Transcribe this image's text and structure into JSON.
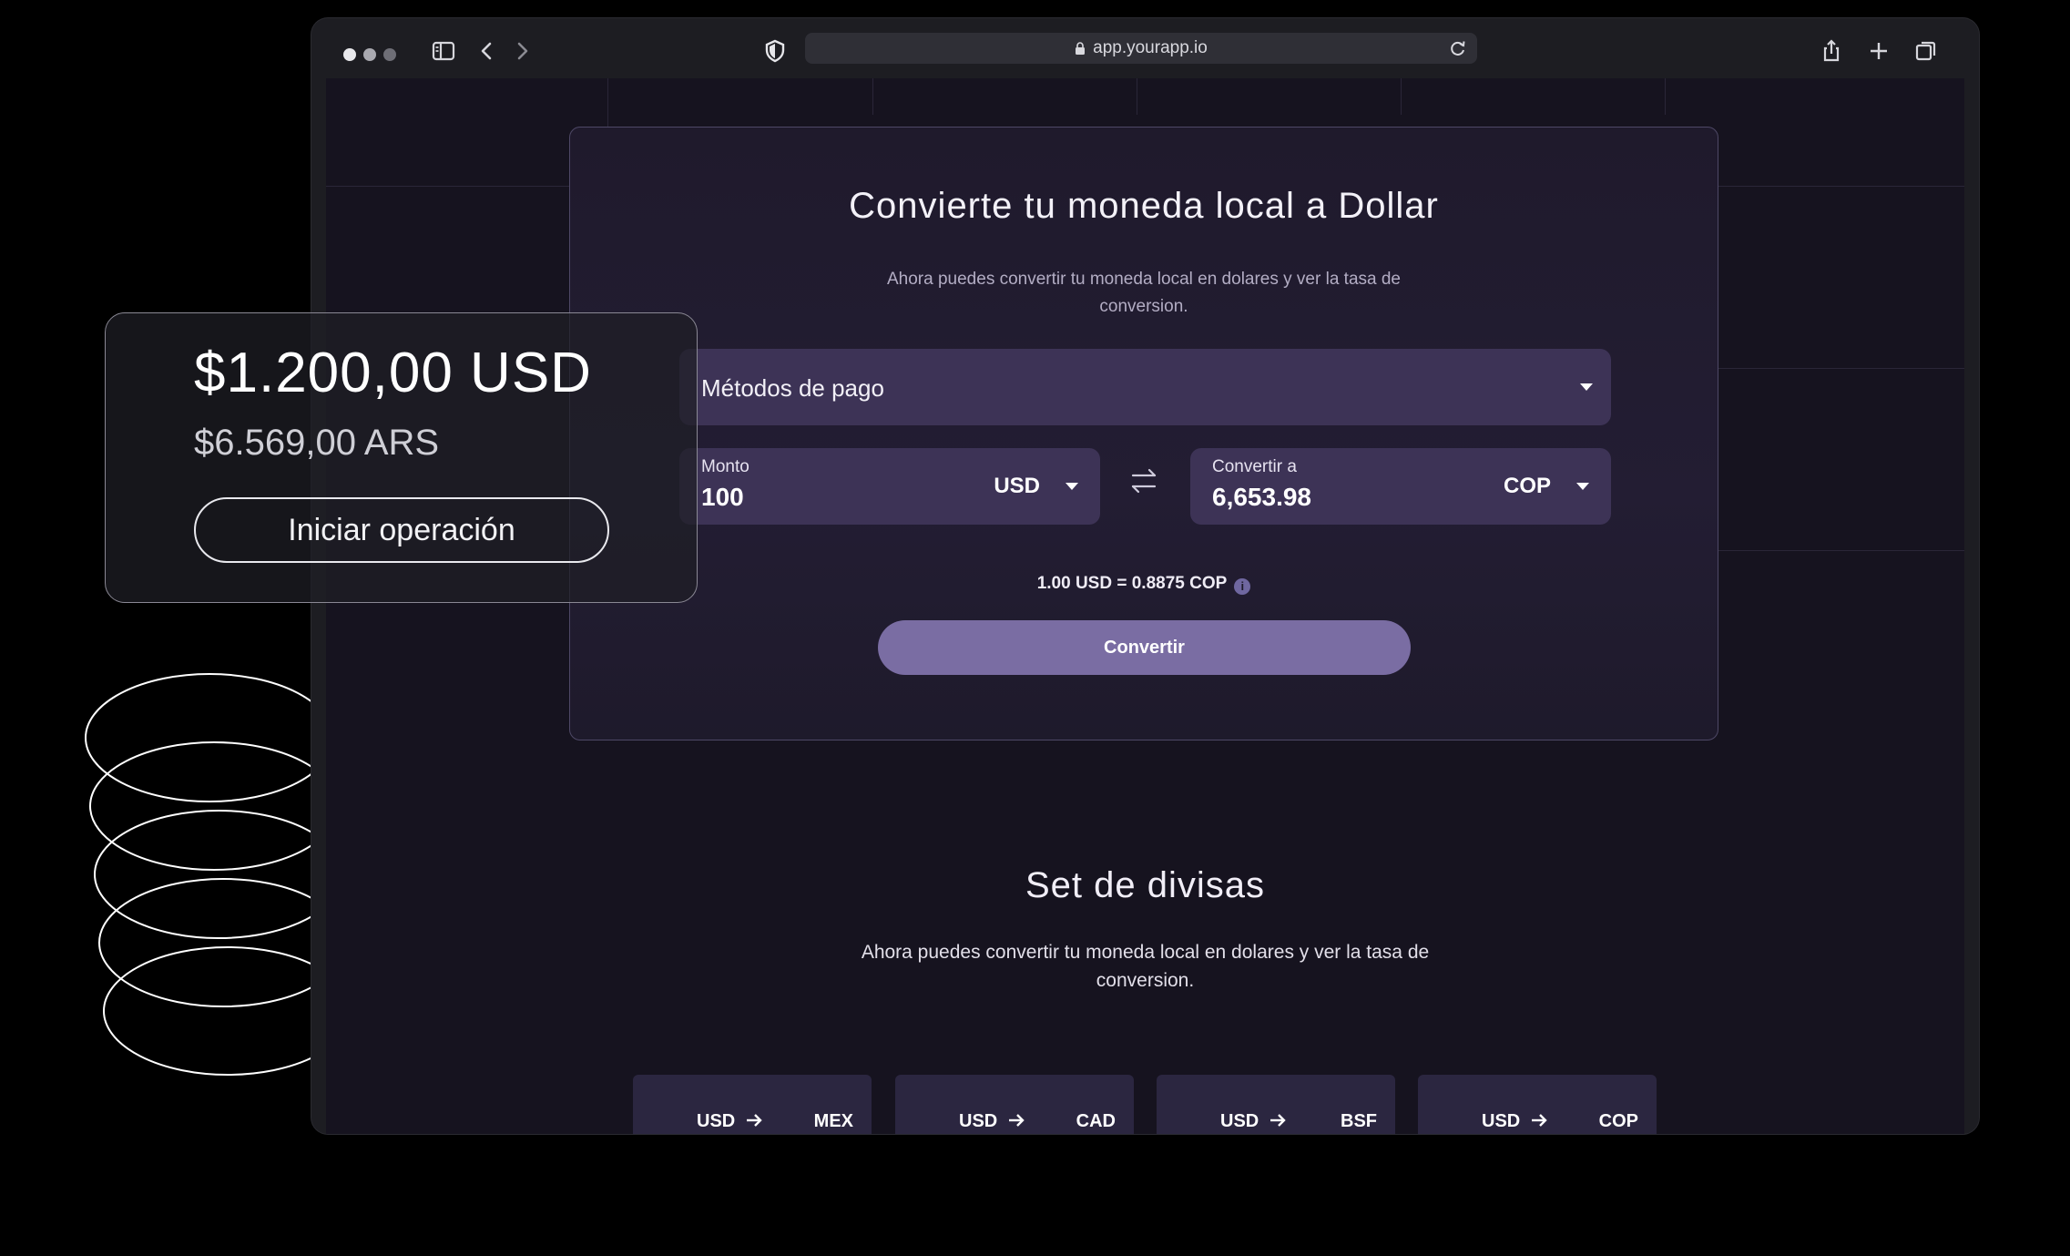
{
  "browser": {
    "url": "app.yourapp.io"
  },
  "converter": {
    "title": "Convierte tu moneda local a Dollar",
    "subtitle": "Ahora puedes convertir tu moneda local en dolares y ver la tasa de conversion.",
    "payment_methods_label": "Métodos de pago",
    "amount": {
      "label": "Monto",
      "value": "100",
      "currency": "USD"
    },
    "convert_to": {
      "label": "Convertir a",
      "value": "6,653.98",
      "currency": "COP"
    },
    "rate_text": "1.00 USD = 0.8875 COP",
    "info_glyph": "i",
    "convert_button": "Convertir"
  },
  "divisas": {
    "title": "Set de divisas",
    "subtitle": "Ahora puedes convertir tu moneda local en dolares y ver la tasa de conversion.",
    "pairs": [
      {
        "from": "USD",
        "to": "MEX"
      },
      {
        "from": "USD",
        "to": "CAD"
      },
      {
        "from": "USD",
        "to": "BSF"
      },
      {
        "from": "USD",
        "to": "COP"
      }
    ]
  },
  "floating_card": {
    "usd_amount": "$1.200,00 USD",
    "ars_amount": "$6.569,00 ARS",
    "button": "Iniciar operación"
  },
  "colors": {
    "background": "#000000",
    "viewport": "#16131f",
    "field": "#3d3356",
    "accent_button": "#7a6da3"
  },
  "icons": [
    "sidebar-icon",
    "back-icon",
    "forward-icon",
    "shield-icon",
    "lock-icon",
    "reload-icon",
    "share-icon",
    "plus-icon",
    "tabs-icon",
    "caret-down-icon",
    "swap-icon",
    "info-icon",
    "arrow-right-icon"
  ]
}
